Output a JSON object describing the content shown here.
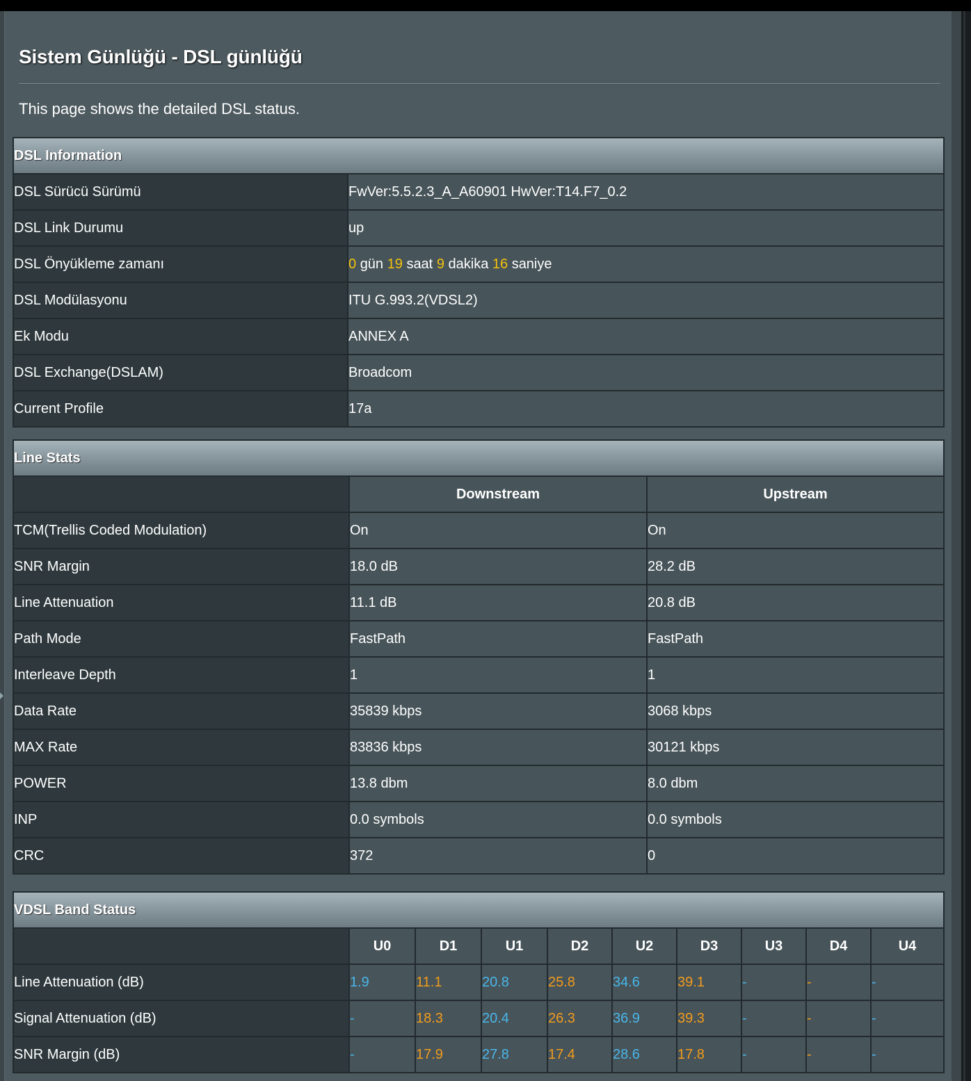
{
  "page": {
    "title": "Sistem Günlüğü - DSL günlüğü",
    "description": "This page shows the detailed DSL status."
  },
  "dsl_info": {
    "header": "DSL Information",
    "rows": [
      {
        "label": "DSL Sürücü Sürümü",
        "value": "FwVer:5.5.2.3_A_A60901 HwVer:T14.F7_0.2"
      },
      {
        "label": "DSL Link Durumu",
        "value": "up"
      },
      {
        "label": "DSL Önyükleme zamanı",
        "uptime": {
          "days": "0",
          "days_unit": "gün",
          "hours": "19",
          "hours_unit": "saat",
          "minutes": "9",
          "minutes_unit": "dakika",
          "seconds": "16",
          "seconds_unit": "saniye"
        }
      },
      {
        "label": "DSL Modülasyonu",
        "value": "ITU G.993.2(VDSL2)"
      },
      {
        "label": "Ek Modu",
        "value": "ANNEX A"
      },
      {
        "label": "DSL Exchange(DSLAM)",
        "value": "Broadcom"
      },
      {
        "label": "Current Profile",
        "value": "17a"
      }
    ]
  },
  "line_stats": {
    "header": "Line Stats",
    "columns": [
      "Downstream",
      "Upstream"
    ],
    "rows": [
      {
        "label": "TCM(Trellis Coded Modulation)",
        "down": "On",
        "up": "On"
      },
      {
        "label": "SNR Margin",
        "down": "18.0 dB",
        "up": "28.2 dB"
      },
      {
        "label": "Line Attenuation",
        "down": "11.1 dB",
        "up": "20.8 dB"
      },
      {
        "label": "Path Mode",
        "down": "FastPath",
        "up": "FastPath"
      },
      {
        "label": "Interleave Depth",
        "down": "1",
        "up": "1"
      },
      {
        "label": "Data Rate",
        "down": "35839 kbps",
        "up": "3068 kbps"
      },
      {
        "label": "MAX Rate",
        "down": "83836 kbps",
        "up": "30121 kbps"
      },
      {
        "label": "POWER",
        "down": "13.8 dbm",
        "up": "8.0 dbm"
      },
      {
        "label": "INP",
        "down": "0.0 symbols",
        "up": "0.0 symbols"
      },
      {
        "label": "CRC",
        "down": "372",
        "up": "0"
      }
    ]
  },
  "vdsl_band": {
    "header": "VDSL Band Status",
    "bands": [
      "U0",
      "D1",
      "U1",
      "D2",
      "U2",
      "D3",
      "U3",
      "D4",
      "U4"
    ],
    "rows": [
      {
        "label": "Line Attenuation (dB)",
        "values": [
          "1.9",
          "11.1",
          "20.8",
          "25.8",
          "34.6",
          "39.1",
          "-",
          "-",
          "-"
        ]
      },
      {
        "label": "Signal Attenuation (dB)",
        "values": [
          "-",
          "18.3",
          "20.4",
          "26.3",
          "36.9",
          "39.3",
          "-",
          "-",
          "-"
        ]
      },
      {
        "label": "SNR Margin (dB)",
        "values": [
          "-",
          "17.9",
          "27.8",
          "17.4",
          "28.6",
          "17.8",
          "-",
          "-",
          "-"
        ]
      }
    ]
  },
  "colors": {
    "upstream_band": "#4ab6ea",
    "downstream_band": "#f29b1d",
    "uptime_highlight": "#f4c20d"
  }
}
